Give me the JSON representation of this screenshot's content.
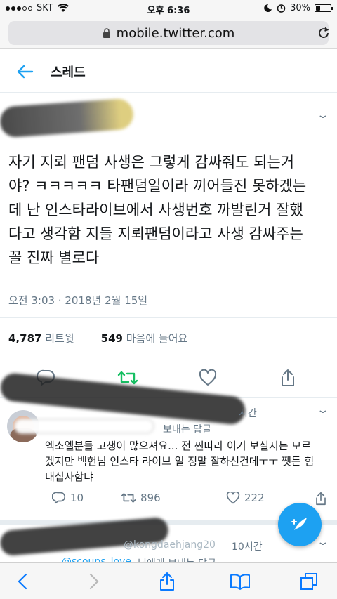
{
  "status_bar": {
    "carrier": "SKT",
    "time": "오후 6:36",
    "battery": "30%",
    "battery_level": 0.3
  },
  "browser": {
    "url": "mobile.twitter.com"
  },
  "header": {
    "title": "스레드"
  },
  "tweet": {
    "text": "자기 지뢰 팬덤 사생은 그렇게 감싸줘도 되는거 야? ㅋㅋㅋㅋㅋ 타팬덤일이라 끼어들진 못하겠는 데 난 인스타라이브에서 사생번호 까발린거 잘했 다고 생각함 지들 지뢰팬덤이라고 사생 감싸주는 꼴 진짜 별로다",
    "lines": [
      "자기 지뢰 팬덤 사생은 그렇게 감싸줘도 되는거",
      "야? ㅋㅋㅋㅋㅋ 타팬덤일이라 끼어들진 못하겠는",
      "데 난 인스타라이브에서 사생번호 까발린거 잘했",
      "다고 생각함 지들 지뢰팬덤이라고 사생 감싸주는",
      "꼴 진짜 별로다"
    ],
    "timestamp": "오전 3:03 · 2018년 2월 15일",
    "retweets": "4,787",
    "retweets_label": "리트윗",
    "likes": "549",
    "likes_label": "마음에 들어요"
  },
  "reply1": {
    "time_fragment": "시간",
    "replying_to": "보내는 답글",
    "lines": [
      "엑소엘분들 고생이 많으셔요... 전 찐따라 이거 보실지는 모르",
      "겠지만 백현님 인스타 라이브 일 정말 잘하신건데ㅜㅜ 쨋든 힘",
      "내십사함댜"
    ],
    "replies": "10",
    "retweets": "896",
    "likes": "222"
  },
  "reply2": {
    "handle_fragment": "@kongdaehjang20",
    "time": "10시간",
    "mention": "@scoups_love",
    "replying_to": "님에게 보내는 답글"
  }
}
